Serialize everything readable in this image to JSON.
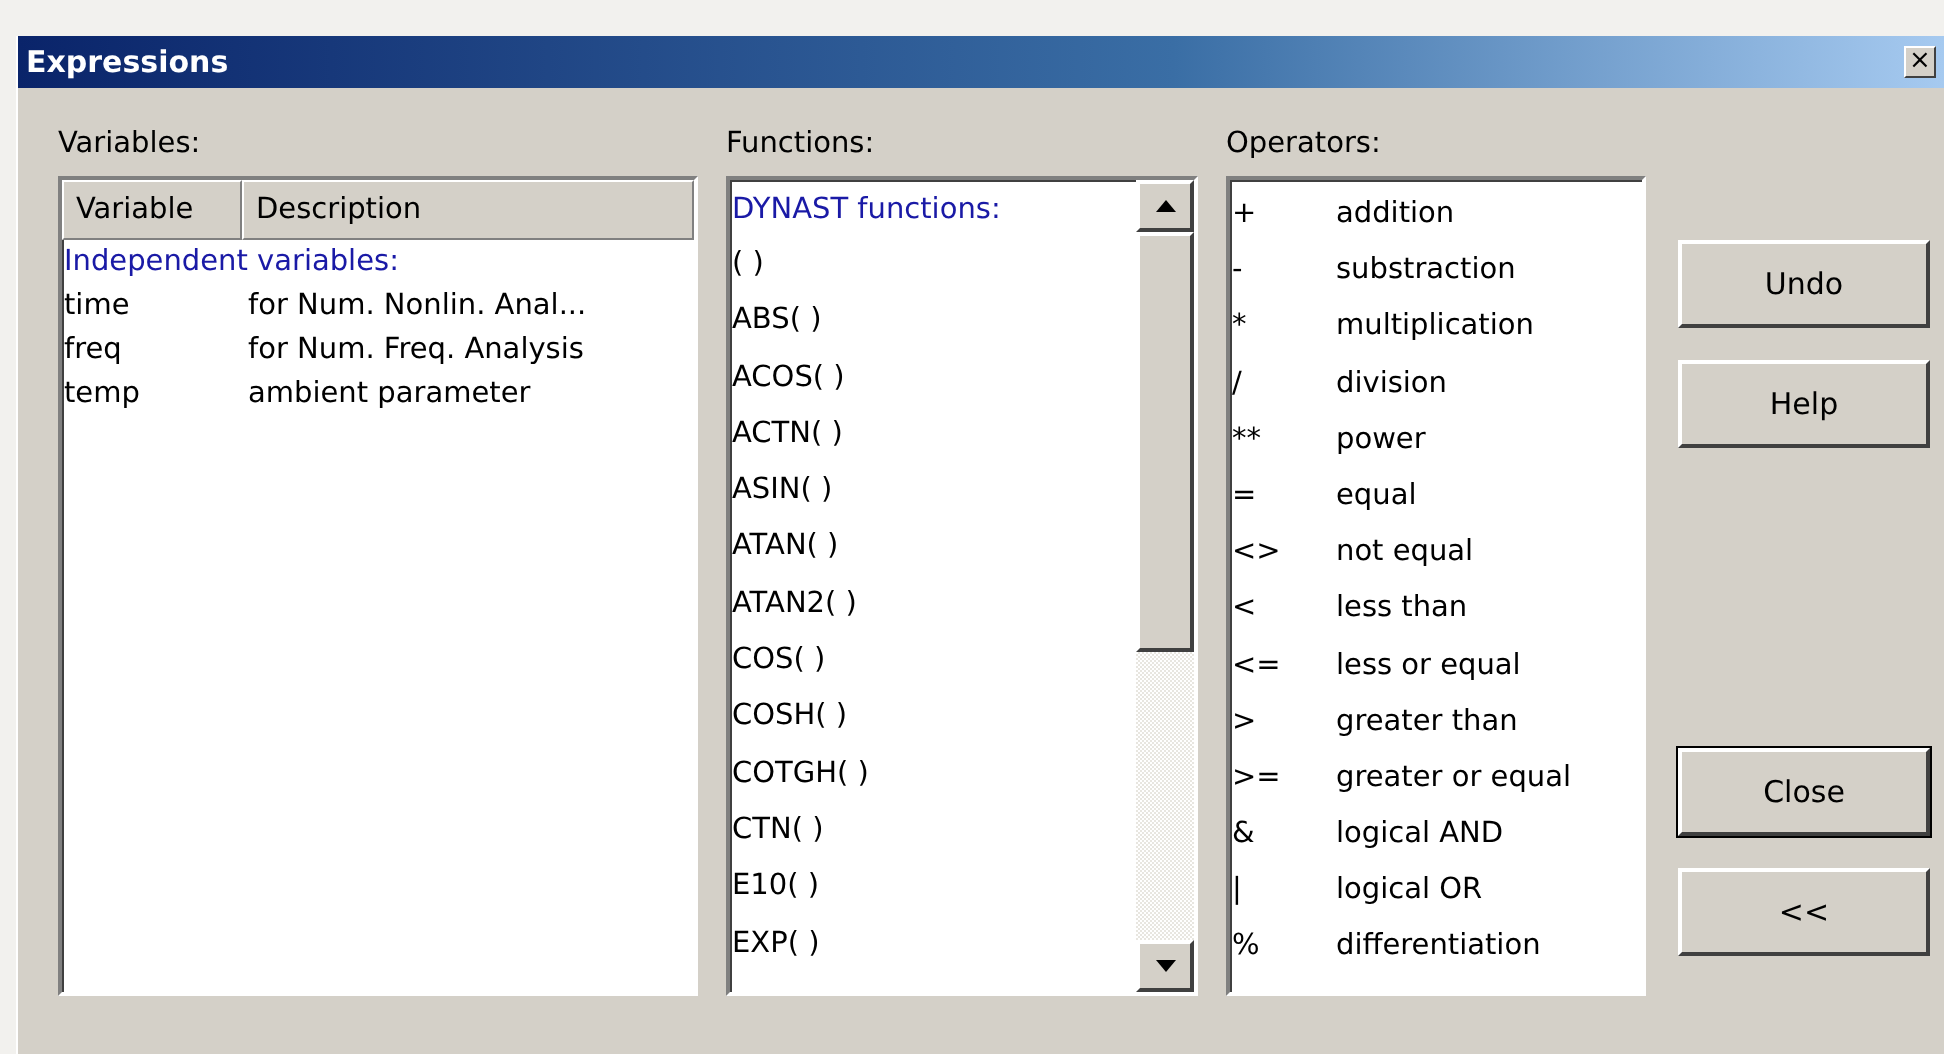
{
  "window": {
    "title": "Expressions",
    "close": "×"
  },
  "variables": {
    "label": "Variables:",
    "columns": [
      "Variable",
      "Description"
    ],
    "group": "Independent variables:",
    "rows": [
      {
        "name": "time",
        "description": "for Num. Nonlin. Anal..."
      },
      {
        "name": "freq",
        "description": "for Num. Freq. Analysis"
      },
      {
        "name": "temp",
        "description": "ambient parameter"
      }
    ]
  },
  "functions": {
    "label": "Functions:",
    "group": "DYNAST functions:",
    "items": [
      "( )",
      "ABS( )",
      "ACOS( )",
      "ACTN( )",
      "ASIN( )",
      "ATAN( )",
      "ATAN2( )",
      "COS( )",
      "COSH( )",
      "COTGH( )",
      "CTN( )",
      "E10( )",
      "EXP( )"
    ]
  },
  "operators": {
    "label": "Operators:",
    "items": [
      {
        "symbol": "+",
        "meaning": "addition"
      },
      {
        "symbol": "-",
        "meaning": "substraction"
      },
      {
        "symbol": "*",
        "meaning": "multiplication"
      },
      {
        "symbol": "/",
        "meaning": "division"
      },
      {
        "symbol": "**",
        "meaning": "power"
      },
      {
        "symbol": "=",
        "meaning": "equal"
      },
      {
        "symbol": "<>",
        "meaning": "not equal"
      },
      {
        "symbol": "<",
        "meaning": "less than"
      },
      {
        "symbol": "<=",
        "meaning": "less or equal"
      },
      {
        "symbol": ">",
        "meaning": "greater than"
      },
      {
        "symbol": ">=",
        "meaning": "greater or equal"
      },
      {
        "symbol": "&",
        "meaning": "logical AND"
      },
      {
        "symbol": "|",
        "meaning": "logical OR"
      },
      {
        "symbol": "%",
        "meaning": "differentiation"
      }
    ]
  },
  "buttons_top": [
    {
      "label": "Undo",
      "default": false
    },
    {
      "label": "Help",
      "default": false
    }
  ],
  "buttons_bottom": [
    {
      "label": "Close",
      "default": true
    },
    {
      "label": "<<",
      "default": false
    }
  ]
}
